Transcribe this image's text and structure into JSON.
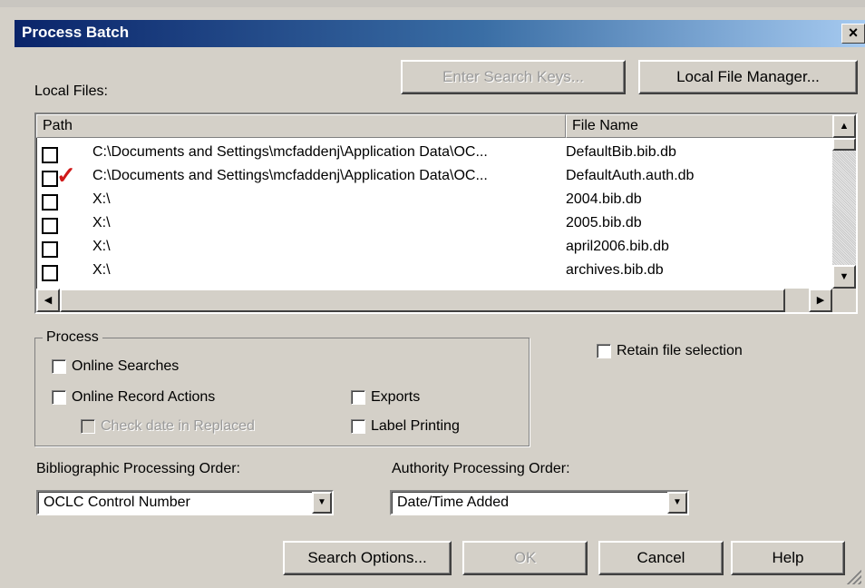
{
  "window": {
    "title": "Process Batch",
    "close_glyph": "×"
  },
  "local_files": {
    "label": "Local Files:",
    "enter_search_keys_label": "Enter Search Keys...",
    "local_file_manager_label": "Local File Manager...",
    "columns": {
      "path": "Path",
      "file_name": "File Name"
    },
    "rows": [
      {
        "path": "C:\\Documents and Settings\\mcfaddenj\\Application Data\\OC...",
        "file_name": "DefaultBib.bib.db",
        "checked": false,
        "mark": ""
      },
      {
        "path": "C:\\Documents and Settings\\mcfaddenj\\Application Data\\OC...",
        "file_name": "DefaultAuth.auth.db",
        "checked": true,
        "mark": "✓"
      },
      {
        "path": "X:\\",
        "file_name": "2004.bib.db",
        "checked": false,
        "mark": ""
      },
      {
        "path": "X:\\",
        "file_name": "2005.bib.db",
        "checked": false,
        "mark": ""
      },
      {
        "path": "X:\\",
        "file_name": "april2006.bib.db",
        "checked": false,
        "mark": ""
      },
      {
        "path": "X:\\",
        "file_name": "archives.bib.db",
        "checked": false,
        "mark": ""
      }
    ],
    "scroll": {
      "up": "▲",
      "down": "▼",
      "left": "◀",
      "right": "▶"
    }
  },
  "process": {
    "legend": "Process",
    "online_searches": "Online Searches",
    "online_record_actions": "Online Record Actions",
    "check_date_in_replaced": "Check date in Replaced",
    "exports": "Exports",
    "label_printing": "Label Printing"
  },
  "retain_file_selection": "Retain file selection",
  "bibliographic_order": {
    "label": "Bibliographic Processing Order:",
    "value": "OCLC Control Number"
  },
  "authority_order": {
    "label": "Authority Processing Order:",
    "value": "Date/Time Added"
  },
  "combo_arrow": "▼",
  "buttons": {
    "search_options": "Search Options...",
    "ok": "OK",
    "cancel": "Cancel",
    "help": "Help"
  }
}
